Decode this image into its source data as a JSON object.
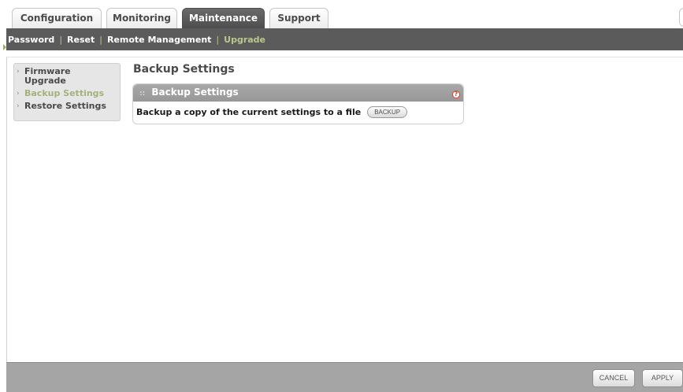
{
  "tabs": [
    {
      "label": "Configuration"
    },
    {
      "label": "Monitoring"
    },
    {
      "label": "Maintenance"
    },
    {
      "label": "Support"
    }
  ],
  "subnav": {
    "items": [
      "Password",
      "Reset",
      "Remote Management",
      "Upgrade"
    ]
  },
  "leftmenu": {
    "items": [
      {
        "label": "Firmware Upgrade"
      },
      {
        "label": "Backup Settings"
      },
      {
        "label": "Restore Settings"
      }
    ]
  },
  "page": {
    "title": "Backup Settings",
    "panel_title": "Backup Settings",
    "help_icon": "?",
    "backup_text": "Backup a copy of the current settings to a file",
    "backup_button": "BACKUP"
  },
  "footer": {
    "cancel": "CANCEL",
    "apply": "APPLY"
  },
  "colors": {
    "nav_bg": "#5b5b5b",
    "accent_green": "#b9c88a",
    "help_red": "#e2412a",
    "bottom_bar": "#a5a5a5"
  }
}
